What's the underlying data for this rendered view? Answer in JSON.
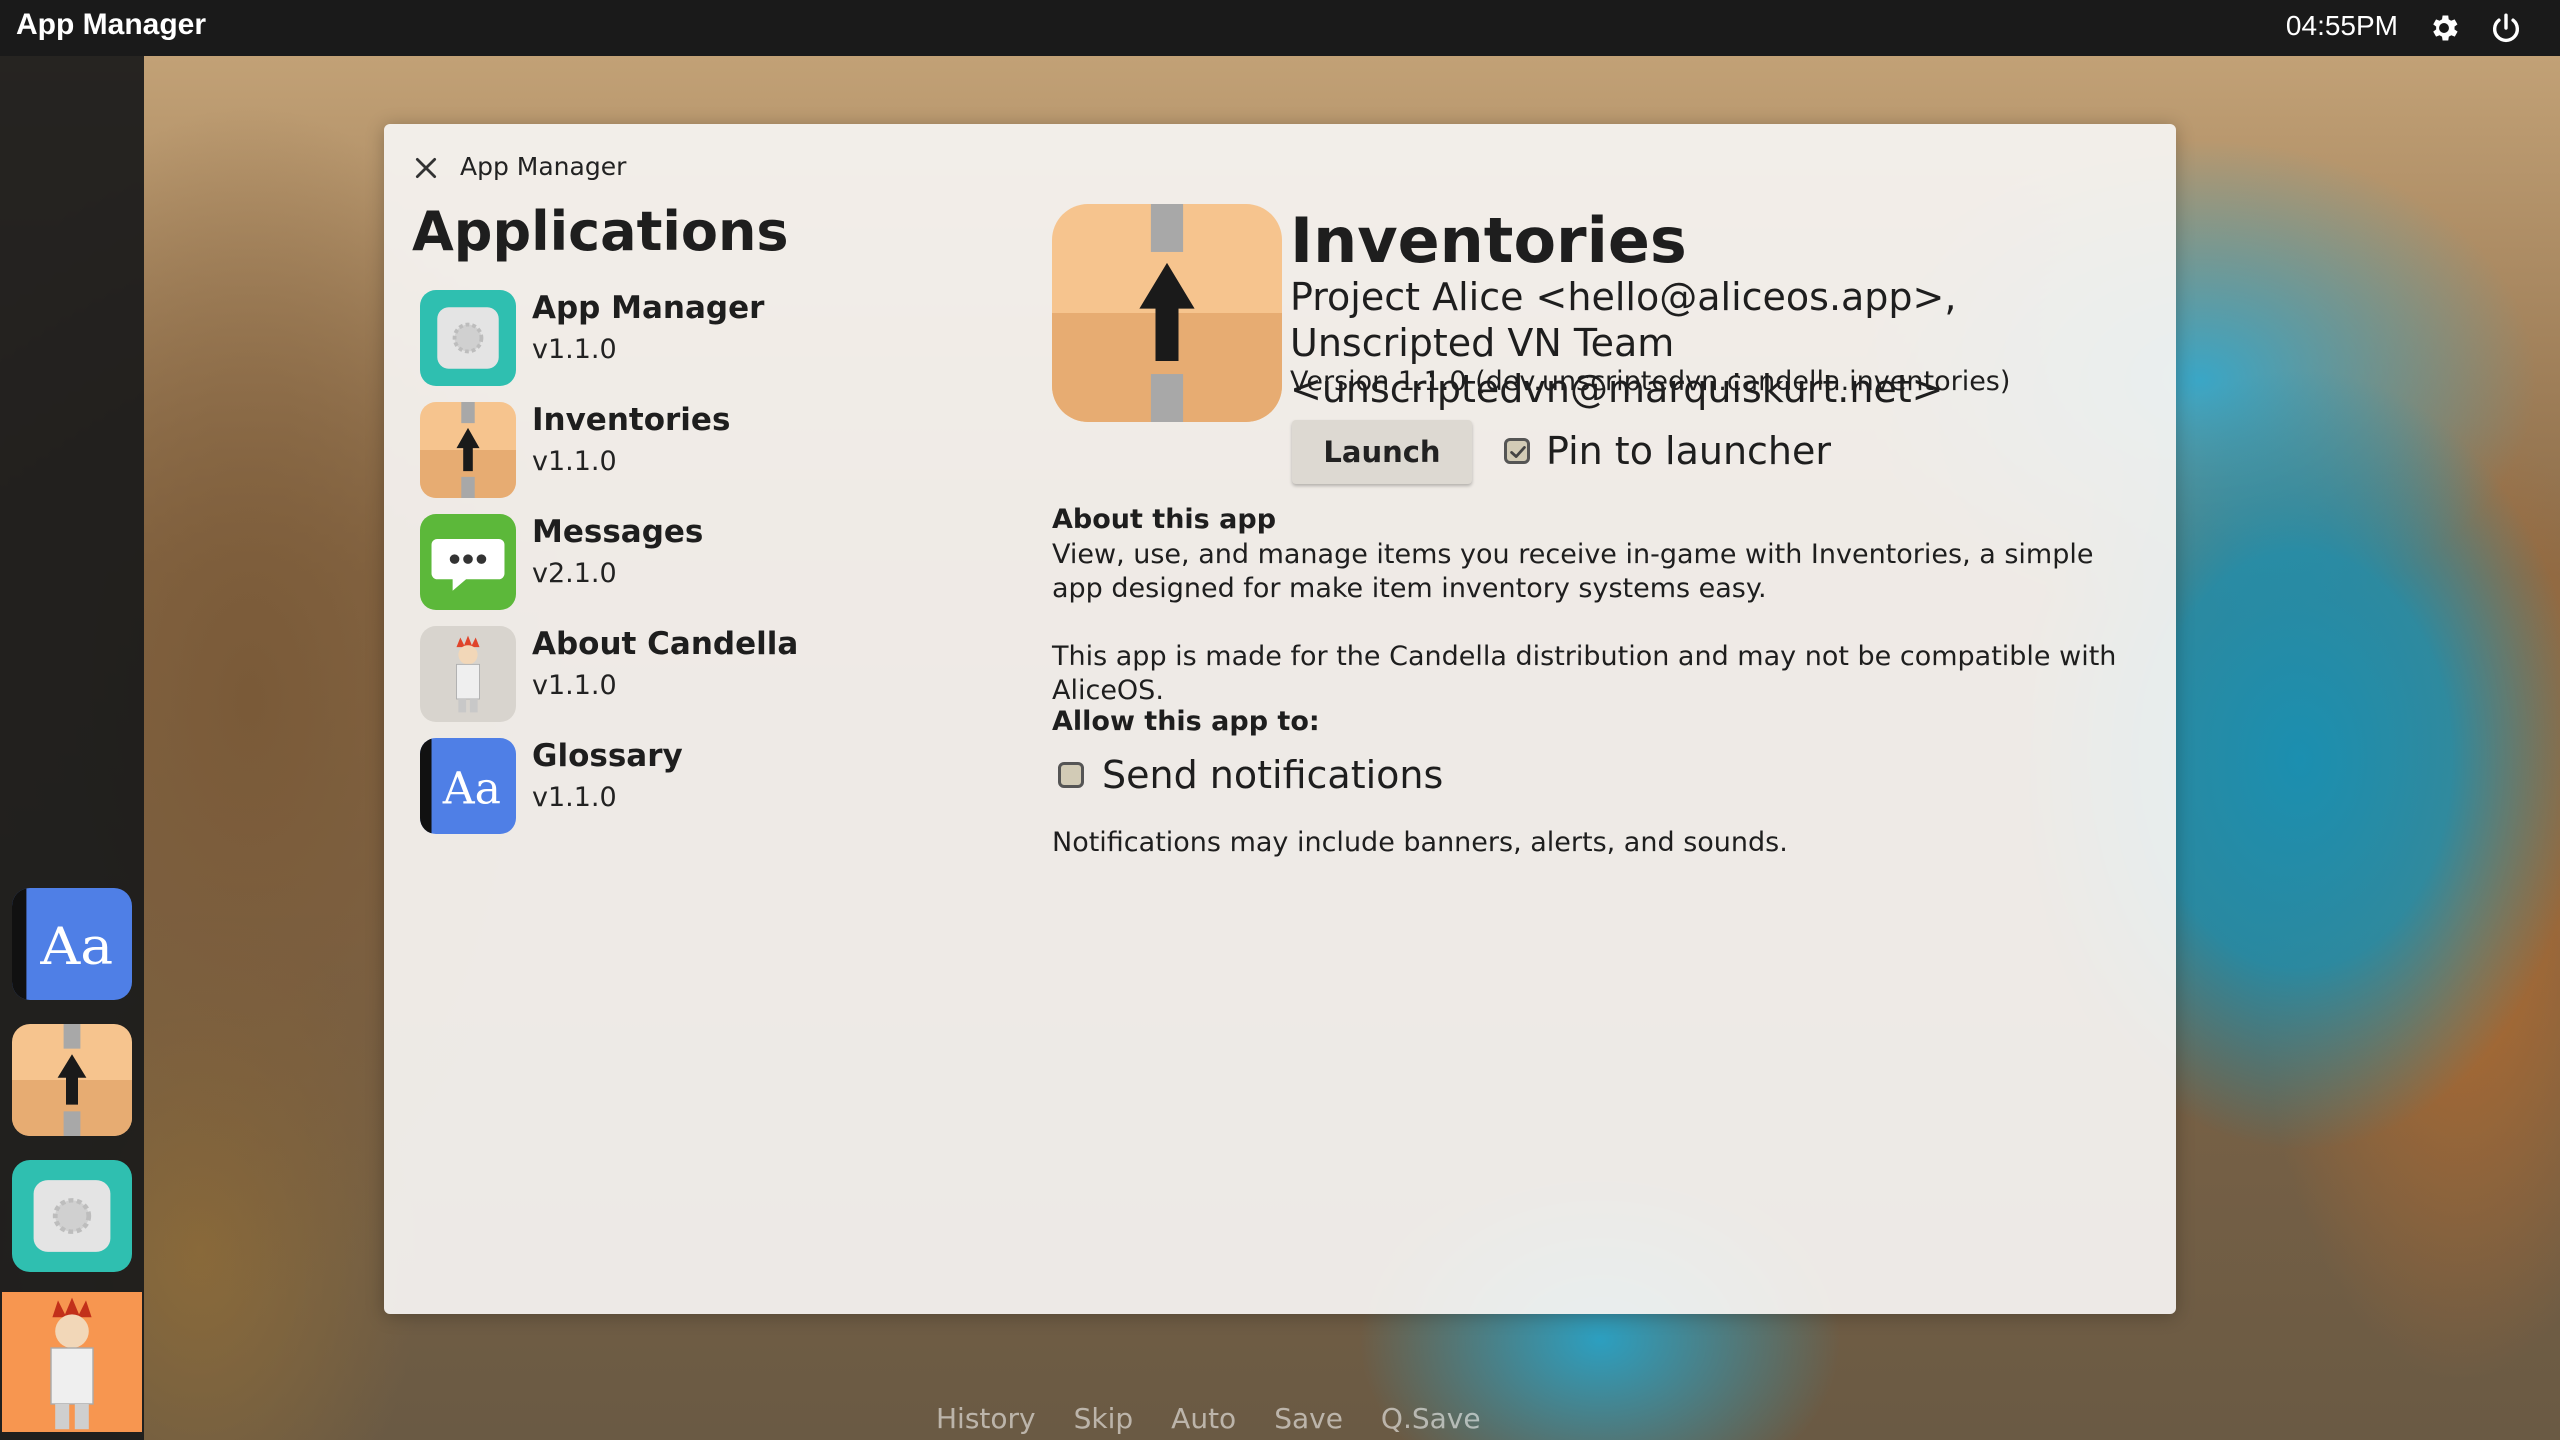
{
  "topbar": {
    "title": "App Manager",
    "time": "04:55PM",
    "settings_icon": "gear-icon",
    "power_icon": "power-icon"
  },
  "dock": {
    "items": [
      {
        "name": "Glossary",
        "icon": "glossary-icon"
      },
      {
        "name": "Inventories",
        "icon": "inventories-icon"
      },
      {
        "name": "App Manager",
        "icon": "app-manager-icon"
      },
      {
        "name": "About Candella",
        "icon": "about-candella-icon"
      }
    ]
  },
  "window": {
    "title": "App Manager",
    "close_icon": "close-icon",
    "heading": "Applications",
    "apps": [
      {
        "name": "App Manager",
        "version": "v1.1.0",
        "icon": "app-manager-icon"
      },
      {
        "name": "Inventories",
        "version": "v1.1.0",
        "icon": "inventories-icon"
      },
      {
        "name": "Messages",
        "version": "v2.1.0",
        "icon": "messages-icon"
      },
      {
        "name": "About Candella",
        "version": "v1.1.0",
        "icon": "about-candella-icon"
      },
      {
        "name": "Glossary",
        "version": "v1.1.0",
        "icon": "glossary-icon"
      }
    ]
  },
  "detail": {
    "name": "Inventories",
    "authors": "Project Alice <hello@aliceos.app>, Unscripted VN Team <unscriptedvn@marquiskurt.net>",
    "version": "Version 1.1.0 (dev.unscriptedvn.candella.inventories)",
    "launch_label": "Launch",
    "pin_label": "Pin to launcher",
    "pin_checked": true,
    "about_heading": "About this app",
    "about_text": "View, use, and manage items you receive in-game with Inventories, a simple app designed for make item inventory systems easy.",
    "compat_text": "This app is made for the Candella distribution and may not be compatible with AliceOS.",
    "allow_heading": "Allow this app to:",
    "notifications_label": "Send notifications",
    "notifications_checked": false,
    "notifications_note": "Notifications may include banners, alerts, and sounds."
  },
  "quickmenu": {
    "items": [
      "History",
      "Skip",
      "Auto",
      "Save",
      "Q.Save"
    ]
  }
}
